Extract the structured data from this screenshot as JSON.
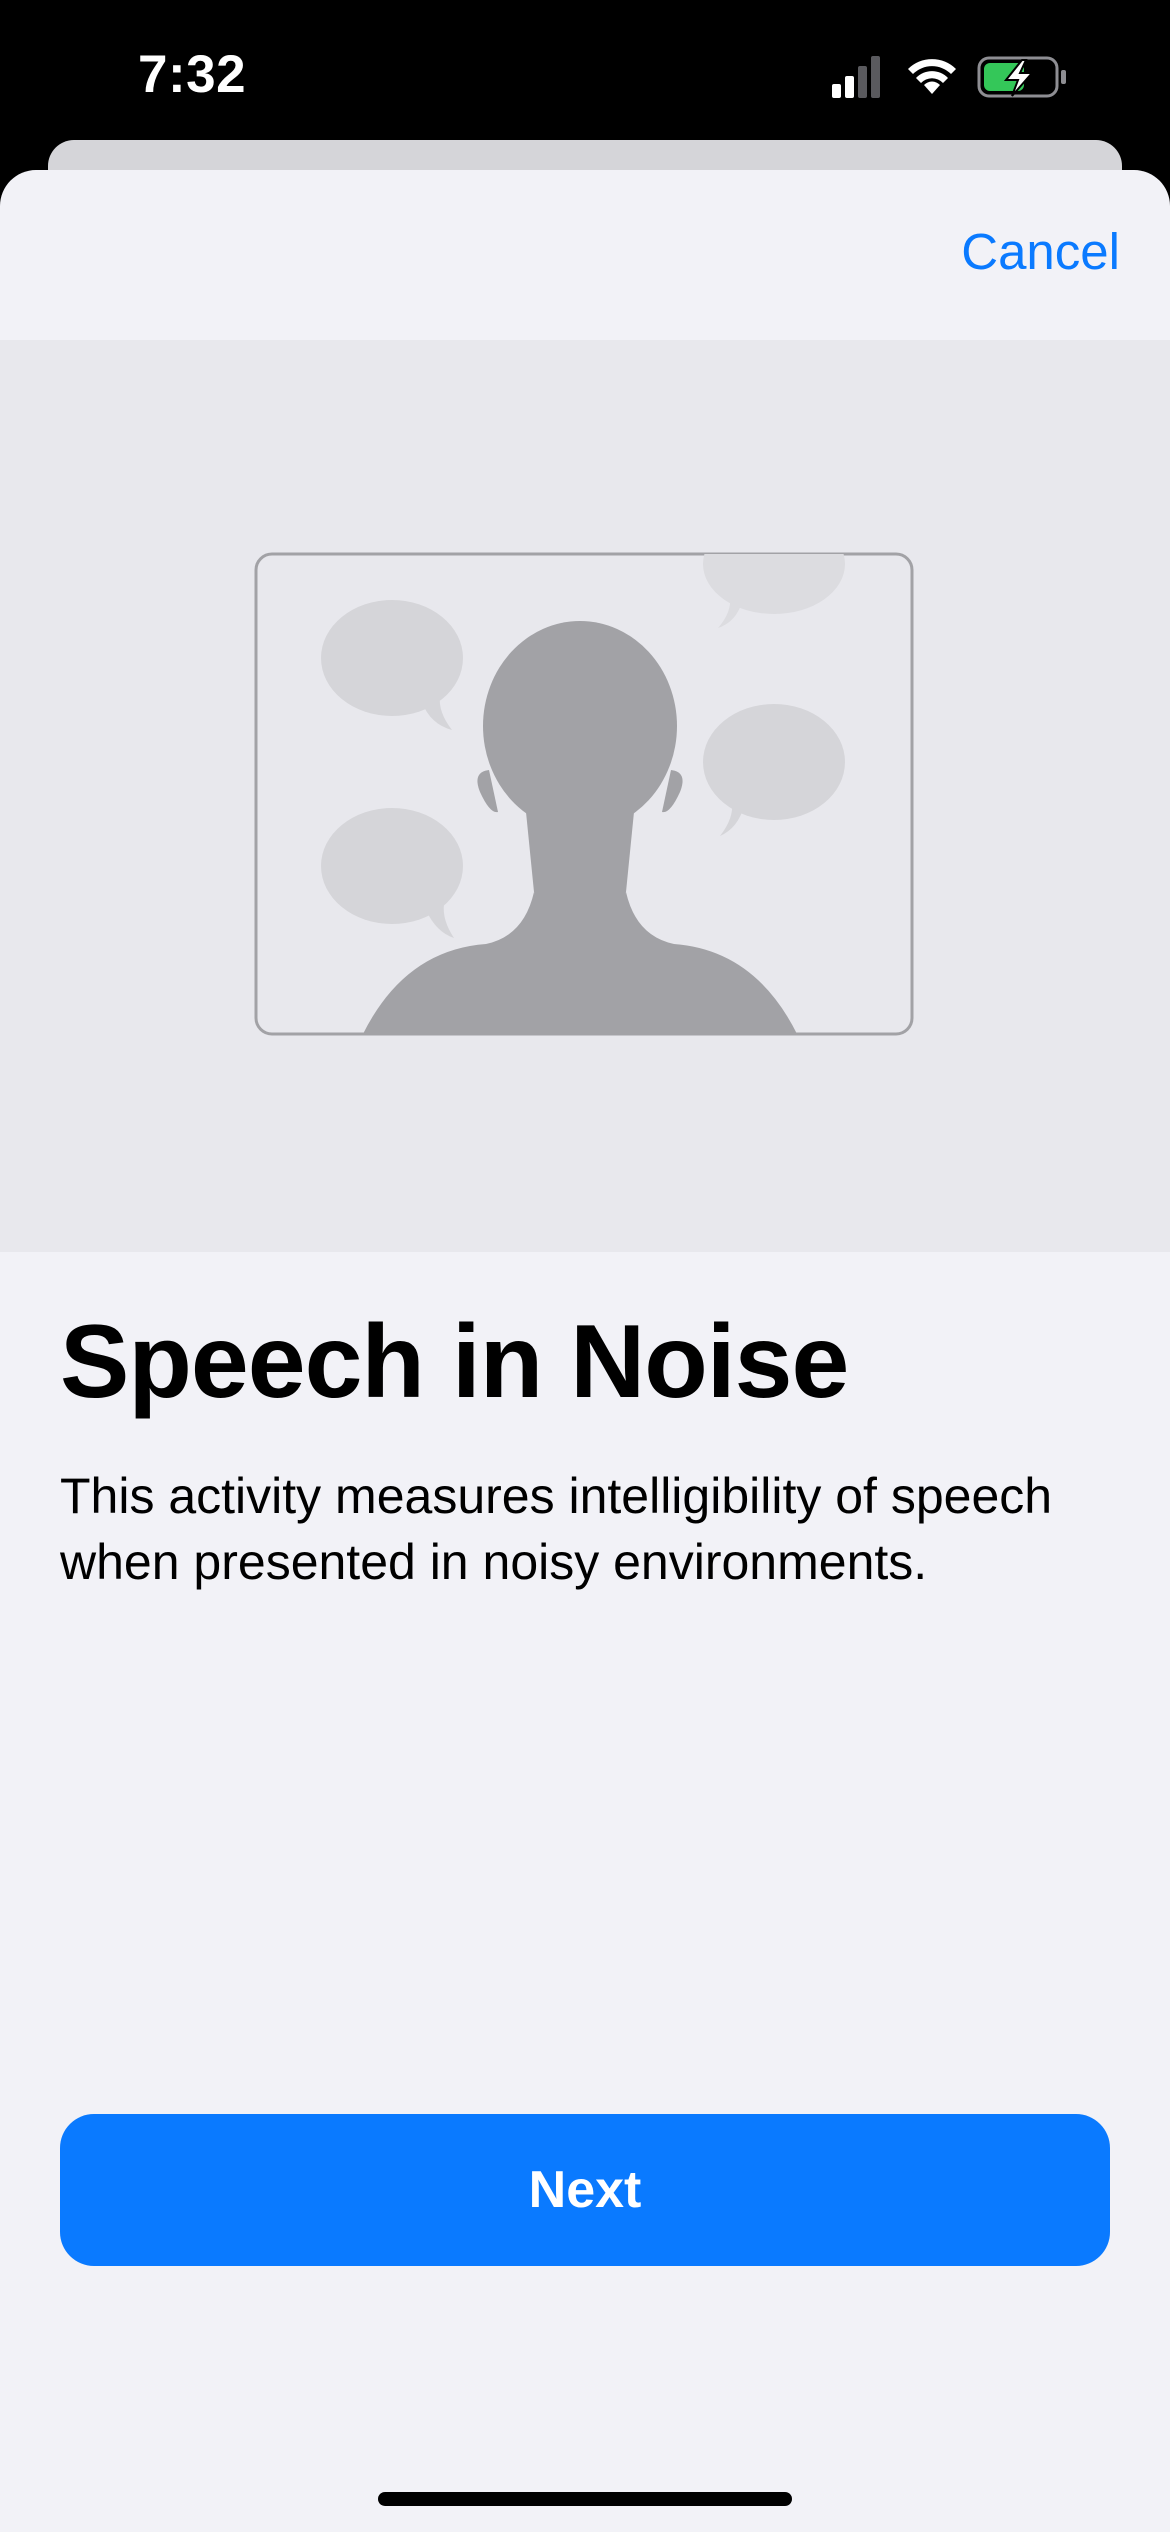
{
  "status_bar": {
    "time": "7:32",
    "icons": [
      "cellular-signal-icon",
      "wifi-icon",
      "battery-charging-icon"
    ],
    "battery_color": "#34c759"
  },
  "nav": {
    "cancel_label": "Cancel"
  },
  "main": {
    "title": "Speech in Noise",
    "description": "This activity measures intelligibility of speech when presented in noisy environments.",
    "illustration_icon": "person-with-speech-bubbles-icon"
  },
  "footer": {
    "next_label": "Next"
  },
  "colors": {
    "accent": "#0a7aff",
    "background": "#f2f2f7",
    "illustration_background": "#e8e8ed"
  }
}
